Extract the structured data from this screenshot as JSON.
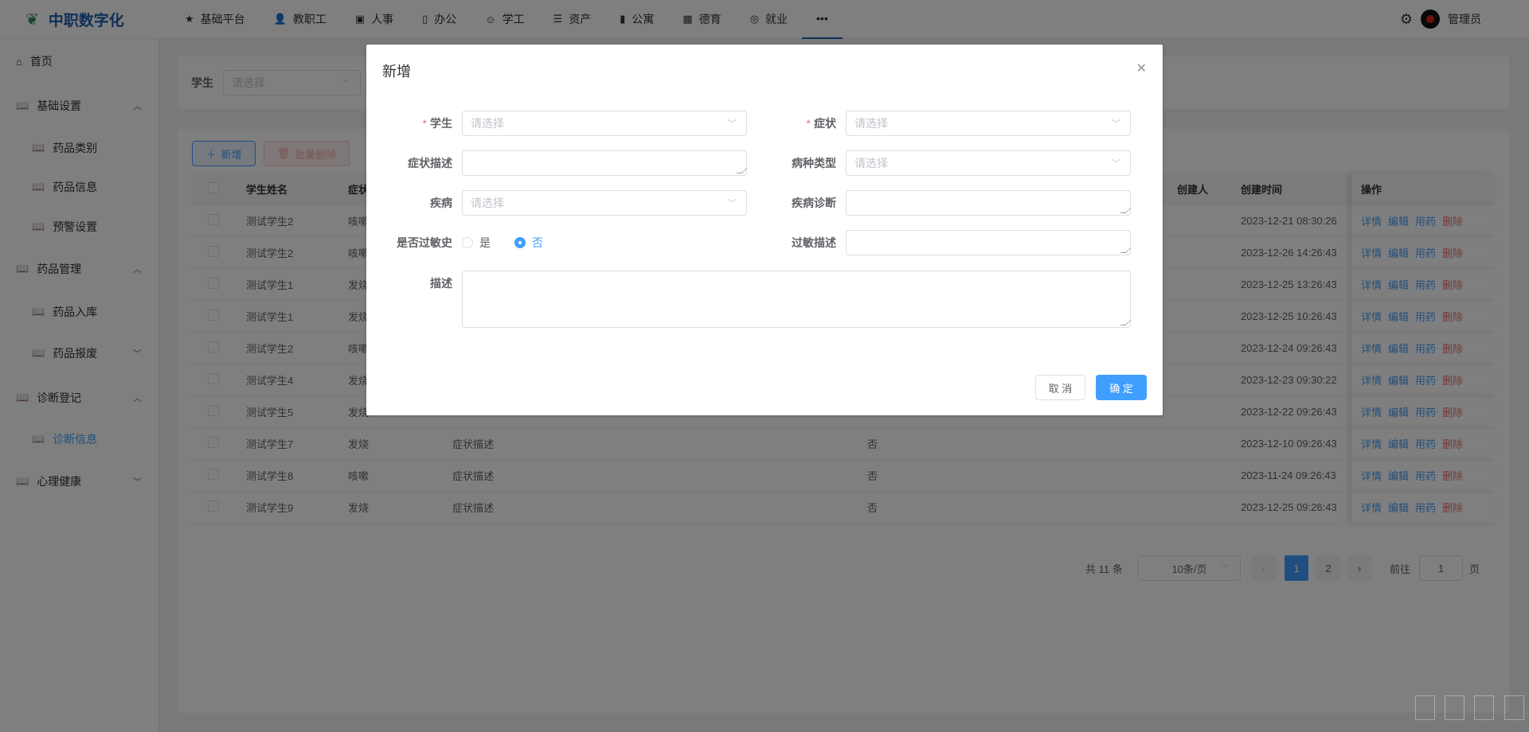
{
  "app": {
    "title": "中职数字化",
    "logo_icon": "leaf-icon"
  },
  "nav": [
    {
      "label": "基础平台",
      "icon": "star-icon"
    },
    {
      "label": "教职工",
      "icon": "user-icon"
    },
    {
      "label": "人事",
      "icon": "id-card-icon"
    },
    {
      "label": "办公",
      "icon": "document-icon"
    },
    {
      "label": "学工",
      "icon": "student-icon"
    },
    {
      "label": "资产",
      "icon": "list-icon"
    },
    {
      "label": "公寓",
      "icon": "building-icon"
    },
    {
      "label": "德育",
      "icon": "grid-icon"
    },
    {
      "label": "就业",
      "icon": "target-icon"
    },
    {
      "label": "•••",
      "icon": "more-icon"
    }
  ],
  "user": {
    "name": "管理员"
  },
  "sidebar": [
    {
      "label": "首页",
      "level": 1,
      "chev": ""
    },
    {
      "label": "基础设置",
      "level": 1,
      "chev": "^"
    },
    {
      "label": "药品类别",
      "level": 2,
      "chev": ""
    },
    {
      "label": "药品信息",
      "level": 2,
      "chev": ""
    },
    {
      "label": "预警设置",
      "level": 2,
      "chev": ""
    },
    {
      "label": "药品管理",
      "level": 1,
      "chev": "^"
    },
    {
      "label": "药品入库",
      "level": 2,
      "chev": ""
    },
    {
      "label": "药品报废",
      "level": 2,
      "chev": "v"
    },
    {
      "label": "诊断登记",
      "level": 1,
      "chev": "^"
    },
    {
      "label": "诊断信息",
      "level": 2,
      "chev": "",
      "active": true
    },
    {
      "label": "心理健康",
      "level": 1,
      "chev": "v"
    }
  ],
  "filter": {
    "label": "学生",
    "placeholder": "请选择"
  },
  "toolbar": {
    "add": "新增",
    "batch_delete": "批量删除"
  },
  "table": {
    "headers": {
      "name": "学生姓名",
      "symptom": "症状",
      "creator": "创建人",
      "created": "创建时间",
      "ops": "操作"
    },
    "ops": [
      "详情",
      "编辑",
      "用药",
      "删除"
    ],
    "rows": [
      {
        "name": "测试学生2",
        "symptom": "咳嗽",
        "desc": "",
        "allergy": "",
        "created": "2023-12-21 08:30:26"
      },
      {
        "name": "测试学生2",
        "symptom": "咳嗽",
        "desc": "",
        "allergy": "",
        "created": "2023-12-26 14:26:43"
      },
      {
        "name": "测试学生1",
        "symptom": "发烧",
        "desc": "",
        "allergy": "",
        "created": "2023-12-25 13:26:43"
      },
      {
        "name": "测试学生1",
        "symptom": "发烧",
        "desc": "",
        "allergy": "",
        "created": "2023-12-25 10:26:43"
      },
      {
        "name": "测试学生2",
        "symptom": "咳嗽",
        "desc": "",
        "allergy": "",
        "created": "2023-12-24 09:26:43"
      },
      {
        "name": "测试学生4",
        "symptom": "发烧",
        "desc": "",
        "allergy": "",
        "created": "2023-12-23 09:30:22"
      },
      {
        "name": "测试学生5",
        "symptom": "发烧",
        "desc": "",
        "allergy": "",
        "created": "2023-12-22 09:26:43"
      },
      {
        "name": "测试学生7",
        "symptom": "发烧",
        "desc": "症状描述",
        "allergy": "否",
        "created": "2023-12-10 09:26:43"
      },
      {
        "name": "测试学生8",
        "symptom": "咳嗽",
        "desc": "症状描述",
        "allergy": "否",
        "created": "2023-11-24 09:26:43"
      },
      {
        "name": "测试学生9",
        "symptom": "发烧",
        "desc": "症状描述",
        "allergy": "否",
        "created": "2023-12-25 09:26:43"
      }
    ]
  },
  "pagination": {
    "total": "共 11 条",
    "page_size": "10条/页",
    "pages": [
      "1",
      "2"
    ],
    "current": "1",
    "goto_label": "前往",
    "goto_value": "1",
    "page_suffix": "页"
  },
  "modal": {
    "title": "新增",
    "fields": {
      "student": {
        "label": "学生",
        "placeholder": "请选择"
      },
      "symptom": {
        "label": "症状",
        "placeholder": "请选择"
      },
      "symptom_desc": {
        "label": "症状描述"
      },
      "disease_type": {
        "label": "病种类型",
        "placeholder": "请选择"
      },
      "disease": {
        "label": "疾病",
        "placeholder": "请选择"
      },
      "diagnosis": {
        "label": "疾病诊断"
      },
      "allergy": {
        "label": "是否过敏史",
        "options": [
          "是",
          "否"
        ],
        "selected": "否"
      },
      "allergy_desc": {
        "label": "过敏描述"
      },
      "desc": {
        "label": "描述"
      }
    },
    "cancel": "取 消",
    "confirm": "确 定"
  },
  "colors": {
    "primary": "#409eff",
    "danger": "#f56c6c",
    "brand": "#1f5fae"
  }
}
